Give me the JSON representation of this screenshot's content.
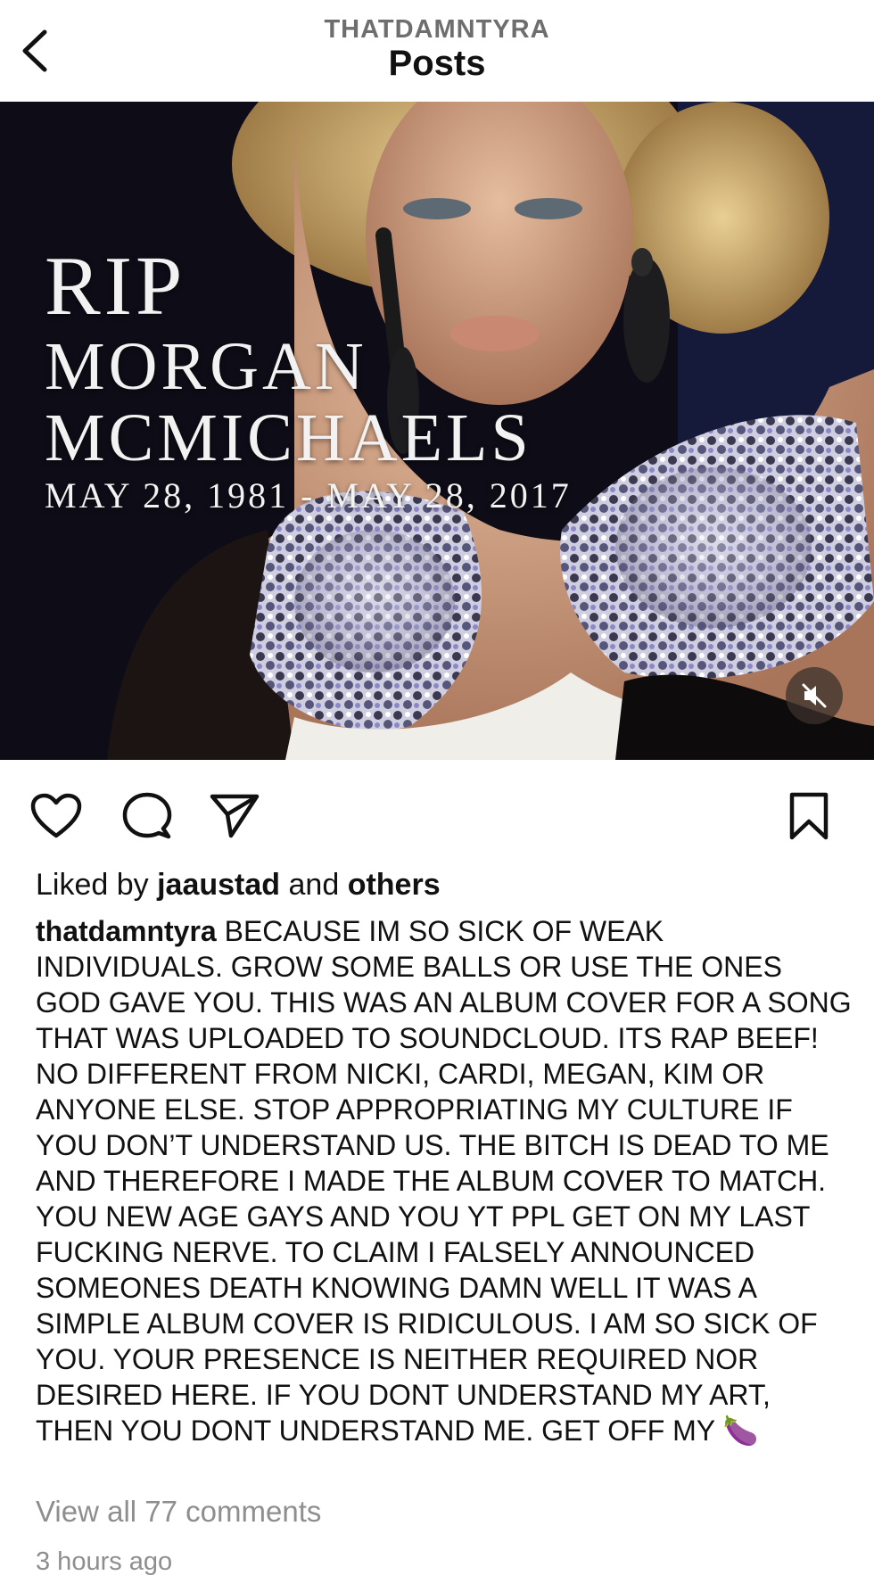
{
  "header": {
    "username": "THATDAMNTYRA",
    "title": "Posts"
  },
  "post": {
    "cover": {
      "line1": "RIP",
      "line2": "MORGAN",
      "line3": "MCMICHAELS",
      "dates": "MAY 28, 1981 - MAY 28, 2017"
    },
    "actions": {
      "icons": [
        "heart-icon",
        "comment-icon",
        "share-icon",
        "bookmark-icon"
      ]
    },
    "likes": {
      "prefix": "Liked by",
      "user": "jaaustad",
      "middle": "and",
      "suffix": "others"
    },
    "caption": {
      "username": "thatdamntyra",
      "text": "BECAUSE IM SO SICK OF WEAK INDIVIDUALS. GROW SOME BALLS OR USE THE ONES GOD GAVE YOU. THIS WAS AN ALBUM COVER FOR A SONG THAT WAS UPLOADED TO SOUNDCLOUD. ITS RAP BEEF! NO DIFFERENT FROM NICKI, CARDI, MEGAN, KIM OR ANYONE ELSE. STOP APPROPRIATING MY CULTURE IF YOU DON’T UNDERSTAND US. THE BITCH IS DEAD TO ME AND THEREFORE I MADE THE ALBUM COVER TO MATCH. YOU NEW AGE GAYS AND YOU YT PPL GET ON MY LAST FUCKING NERVE. TO CLAIM I FALSELY ANNOUNCED SOMEONES DEATH KNOWING DAMN WELL IT WAS A SIMPLE ALBUM COVER IS RIDICULOUS. I AM SO SICK OF YOU. YOUR PRESENCE IS NEITHER REQUIRED NOR DESIRED HERE. IF YOU DONT UNDERSTAND MY ART, THEN YOU DONT UNDERSTAND ME. GET OFF MY",
      "emoji": "🍆"
    },
    "view_comments": "View all 77 comments",
    "timestamp": "3 hours ago"
  }
}
